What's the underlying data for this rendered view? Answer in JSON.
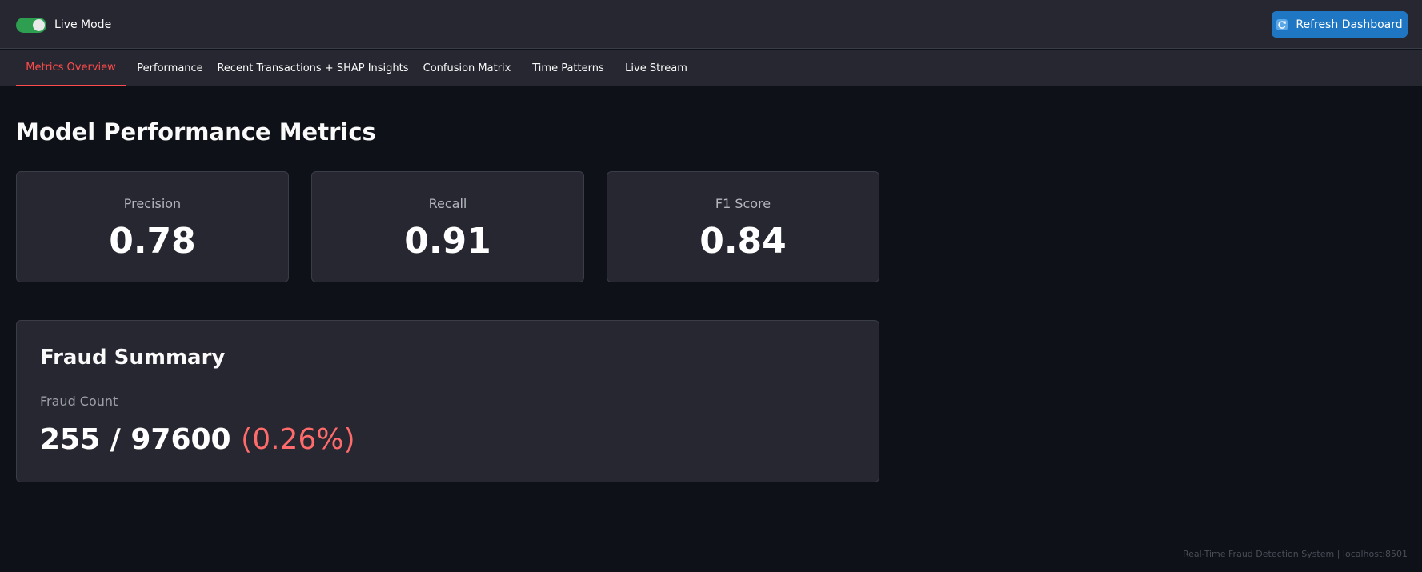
{
  "header": {
    "live_mode_label": "Live Mode",
    "live_mode_on": true,
    "refresh_label": "Refresh Dashboard"
  },
  "tabs": [
    {
      "label": "Metrics Overview",
      "active": true
    },
    {
      "label": "Performance",
      "active": false
    },
    {
      "label": "Recent Transactions + SHAP Insights",
      "active": false
    },
    {
      "label": "Confusion Matrix",
      "active": false
    },
    {
      "label": "Time Patterns",
      "active": false
    },
    {
      "label": "Live Stream",
      "active": false
    }
  ],
  "main": {
    "title": "Model Performance Metrics",
    "metrics": [
      {
        "label": "Precision",
        "value": "0.78"
      },
      {
        "label": "Recall",
        "value": "0.91"
      },
      {
        "label": "F1 Score",
        "value": "0.84"
      }
    ],
    "fraud_summary": {
      "title": "Fraud Summary",
      "label": "Fraud Count",
      "count_text": "255 / 97600",
      "percent_text": "(0.26%)"
    }
  },
  "footer": {
    "text": "Real-Time Fraud Detection System | localhost:8501"
  },
  "colors": {
    "accent": "#ff4b4b",
    "button": "#1f77c4",
    "toggle_on": "#2e9e50",
    "percent": "#ff6b6b"
  }
}
